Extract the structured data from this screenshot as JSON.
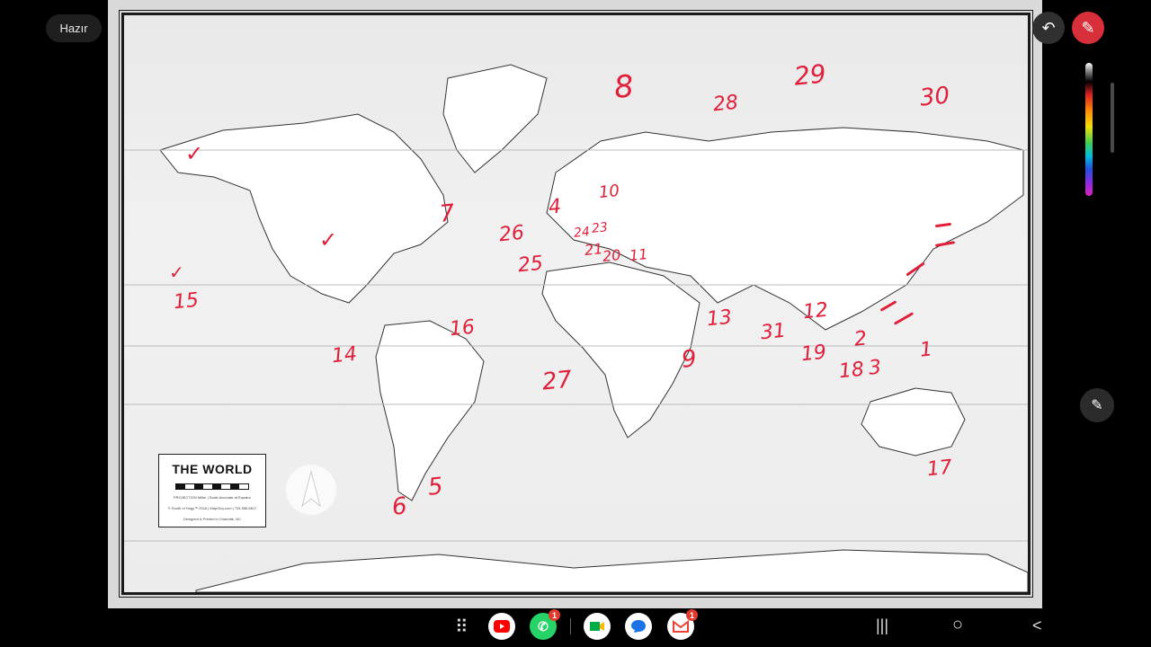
{
  "status": {
    "label": "Hazır"
  },
  "legend": {
    "title": "THE WORLD",
    "note1": "PROJECTION Miller | Scale Accurate at Equator",
    "note2": "© South of Hogy™ 2016 | MapGivy.com | 734.556.6817",
    "note3": "Designed & Printed in Charlotte, NC"
  },
  "annotations": [
    "8",
    "29",
    "28",
    "30",
    "10",
    "4",
    "7",
    "26",
    "24",
    "23",
    "25",
    "21",
    "20",
    "11",
    "15",
    "16",
    "13",
    "31",
    "12",
    "19",
    "2",
    "1",
    "14",
    "9",
    "27",
    "18",
    "3",
    "17",
    "5",
    "6"
  ],
  "controls": {
    "undo_icon": "undo-icon",
    "pen_icon": "pen-icon",
    "side_pen_icon": "pen-icon"
  },
  "apps": [
    {
      "name": "YouTube",
      "color": "#ff0000"
    },
    {
      "name": "WhatsApp",
      "color": "#25d366",
      "badge": "1"
    },
    {
      "name": "Meet",
      "color": "#ffffff"
    },
    {
      "name": "Messages",
      "color": "#1a73e8"
    },
    {
      "name": "Gmail",
      "color": "#ffffff",
      "badge": "1"
    }
  ],
  "nav": {
    "recents": "|||",
    "home": "○",
    "back": "<"
  }
}
